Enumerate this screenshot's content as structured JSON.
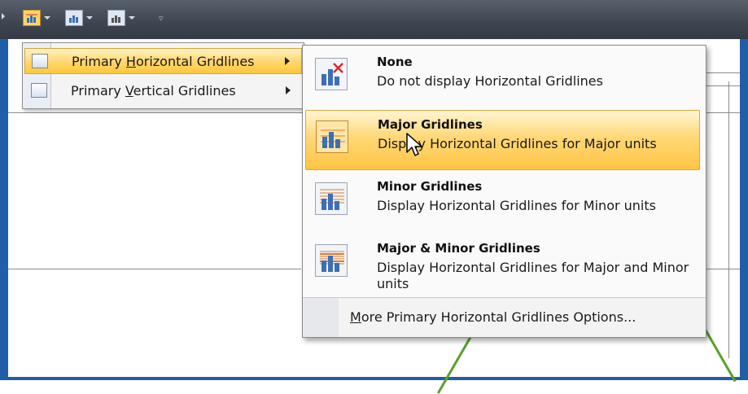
{
  "toolbar": {
    "buttons": [
      {
        "icon": "gridlines-icon",
        "state": "active"
      },
      {
        "icon": "chart-area-icon",
        "state": "normal"
      },
      {
        "icon": "chart-wall-icon",
        "state": "normal"
      }
    ],
    "overflow_icon": "more-icon"
  },
  "submenu": {
    "items": [
      {
        "label": "Primary Horizontal Gridlines",
        "mnemonic": "H",
        "highlighted": true,
        "icon": "horizontal-gridlines-icon"
      },
      {
        "label": "Primary Vertical Gridlines",
        "mnemonic": "V",
        "highlighted": false,
        "icon": "vertical-gridlines-icon"
      }
    ]
  },
  "dropdown": {
    "options": [
      {
        "title": "None",
        "description": "Do not display Horizontal Gridlines",
        "icon": "no-gridlines-icon",
        "highlighted": false
      },
      {
        "title": "Major Gridlines",
        "description": "Display Horizontal Gridlines for Major units",
        "icon": "major-gridlines-icon",
        "highlighted": true
      },
      {
        "title": "Minor Gridlines",
        "description": "Display Horizontal Gridlines for Minor units",
        "icon": "minor-gridlines-icon",
        "highlighted": false
      },
      {
        "title": "Major & Minor Gridlines",
        "description": "Display Horizontal Gridlines for Major and Minor units",
        "icon": "major-minor-gridlines-icon",
        "highlighted": false
      }
    ],
    "footer": {
      "label": "More Primary Horizontal Gridlines Options...",
      "mnemonic": "M"
    }
  },
  "colors": {
    "frame": "#1f5fa8",
    "highlight": "#ffd873",
    "chart_line": "#5aa02c"
  }
}
